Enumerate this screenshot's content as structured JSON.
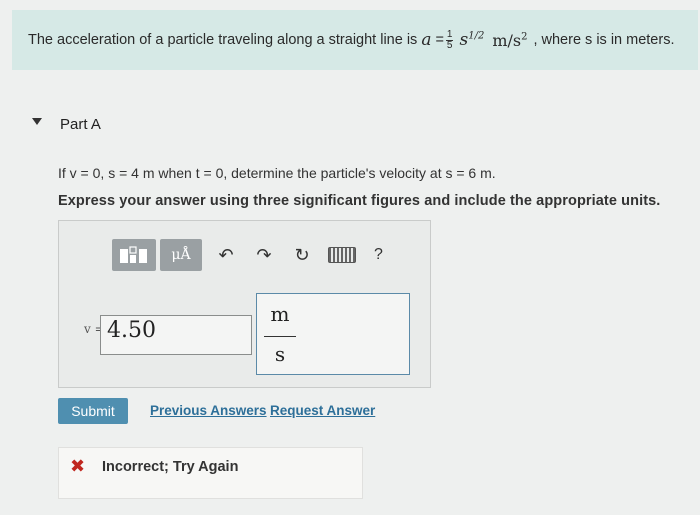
{
  "problem": {
    "text_before": "The acceleration of a particle traveling along a straight line is",
    "var_a": "a",
    "equals": "=",
    "frac_num": "1",
    "frac_den": "5",
    "var_s": "s",
    "exponent": "1/2",
    "unit_base": "m/s",
    "unit_exp": "2",
    "text_after": ", where s is in meters."
  },
  "part": {
    "title": "Part A"
  },
  "question": {
    "text": "If v = 0, s = 4 m when t = 0, determine the particle's velocity at s = 6 m.",
    "instruction": "Express your answer using three significant figures and include the appropriate units."
  },
  "toolbar": {
    "units_label": "μÅ",
    "undo": "↶",
    "redo": "↷",
    "reset": "↻",
    "help": "?"
  },
  "answer": {
    "variable_label": "v =",
    "value": "4.50",
    "unit_numerator": "m",
    "unit_denominator": "s"
  },
  "actions": {
    "submit": "Submit",
    "previous_answers": "Previous Answers",
    "request_answer": "Request Answer"
  },
  "feedback": {
    "icon": "✖",
    "text": "Incorrect; Try Again"
  },
  "colors": {
    "problem_bg": "#d6e9e6",
    "submit_bg": "#4f8fb0",
    "link": "#2d6f99",
    "error": "#c0261e"
  }
}
